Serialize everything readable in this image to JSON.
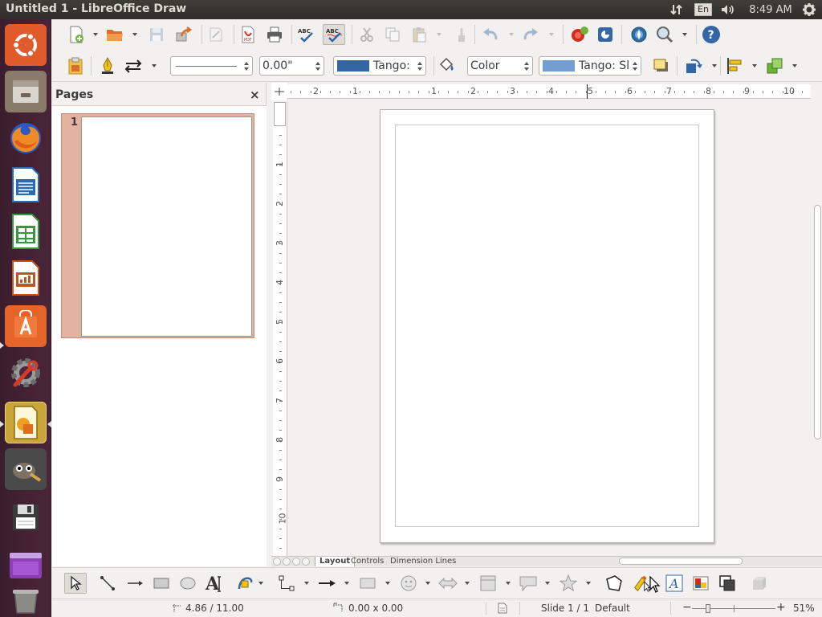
{
  "window": {
    "title": "Untitled 1 - LibreOffice Draw"
  },
  "panel": {
    "lang": "En",
    "time": "8:49 AM",
    "icons": [
      "network-sort-icon",
      "volume-icon",
      "power-gear-icon"
    ]
  },
  "launcher": {
    "items": [
      "ubuntu-logo-icon",
      "files-icon",
      "firefox-icon",
      "writer-icon",
      "calc-icon",
      "impress-icon",
      "software-center-icon",
      "system-settings-icon",
      "draw-icon",
      "gimp-icon",
      "floppy-icon",
      "media-icon",
      "trash-icon"
    ]
  },
  "line_toolbar": {
    "line_width": "0.00\"",
    "line_color": "Tango:",
    "area_style": "Color",
    "area_color": "Tango: Sl",
    "colors": {
      "line": "#3465a4",
      "area": "#729fcf"
    }
  },
  "pages_pane": {
    "title": "Pages",
    "close": "×",
    "page_number": "1"
  },
  "ruler_h": {
    "labels": [
      "2",
      "1",
      "1",
      "2",
      "3",
      "4",
      "5",
      "6",
      "7",
      "8",
      "9",
      "10"
    ]
  },
  "ruler_v": {
    "labels": [
      "1",
      "2",
      "3",
      "4",
      "5",
      "6",
      "7",
      "8",
      "9",
      "10"
    ]
  },
  "tabs": {
    "layout": "Layout",
    "controls": "Controls",
    "dimension": "Dimension Lines"
  },
  "status": {
    "position": "4.86 / 11.00",
    "size": "0.00 x 0.00",
    "slide": "Slide 1 / 1",
    "master": "Default",
    "zoom_minus": "−",
    "zoom_plus": "+",
    "zoom": "51%"
  }
}
